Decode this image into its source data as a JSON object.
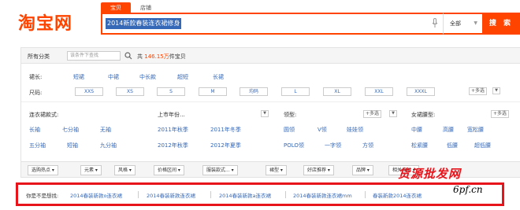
{
  "header": {
    "logo": "淘宝网",
    "tabs": [
      {
        "label": "宝贝",
        "active": true
      },
      {
        "label": "店铺",
        "active": false
      }
    ],
    "search_value": "2014新款春装连衣裙修身",
    "scope": "全部",
    "search_button": "搜 索"
  },
  "topbar": {
    "all_categories": "所有分类",
    "category_placeholder": "该条件下查找",
    "total_prefix": "共",
    "total_number": "146.15万",
    "total_suffix": "件宝贝"
  },
  "skirt_length": {
    "label": "裙长:",
    "options": [
      "短裙",
      "中裙",
      "中长款",
      "超短",
      "长裙"
    ]
  },
  "size": {
    "label": "尺码:",
    "options": [
      "XXS",
      "XS",
      "S",
      "M",
      "均码",
      "L",
      "XL",
      "XXL",
      "XXXL"
    ],
    "more": "+多选"
  },
  "sleeve": {
    "title": "连衣裙款式:",
    "options": [
      "长袖",
      "七分袖",
      "无袖",
      "五分袖",
      "短袖",
      "九分袖"
    ]
  },
  "season": {
    "title": "上市年份...",
    "options": [
      "2011年秋季",
      "2011年冬季",
      "2012年秋季",
      "2012年夏季"
    ]
  },
  "collar": {
    "title": "领型:",
    "more": "+多选",
    "options": [
      "圆领",
      "V领",
      "娃娃领",
      "POLO领",
      "一字领",
      "方领"
    ]
  },
  "waist": {
    "title": "女裙腰型:",
    "more": "+多选",
    "options": [
      "中腰",
      "高腰",
      "宽松腰",
      "松紧腰",
      "低腰",
      "超低腰"
    ]
  },
  "sort_buttons": [
    "选购热点",
    "元素",
    "风格",
    "价格区间",
    "服装款式...",
    "裙型",
    "好店推荐",
    "品牌",
    "相关分类"
  ],
  "suggestions": {
    "label": "你是不是想找:",
    "items": [
      "2014春装新款o连衣裙",
      "2014春装新款连衣裙",
      "2014春装新款a连衣裙",
      "2014春装新款连衣裙mm",
      "春装新款2014连衣裙"
    ]
  },
  "watermark": {
    "line1": "货源批发网",
    "line2": "6pf.cn"
  },
  "colors": {
    "brand": "#ff4400",
    "link": "#3568b7",
    "highlight": "#e8141c"
  }
}
